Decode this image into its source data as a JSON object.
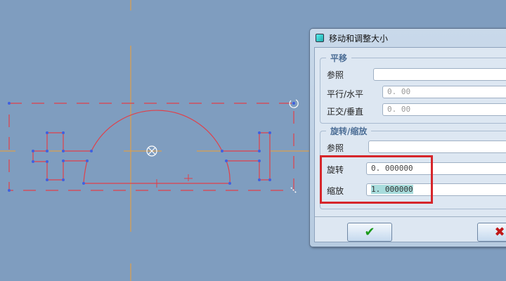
{
  "dialog": {
    "title": "移动和调整大小",
    "translate_group": "平移",
    "translate_ref_label": "参照",
    "translate_ref_value": "",
    "parallel_label": "平行/水平",
    "parallel_value": "0. 00",
    "ortho_label": "正交/垂直",
    "ortho_value": "0. 00",
    "rotscale_group": "旋转/缩放",
    "rot_ref_label": "参照",
    "rot_ref_value": "",
    "rotate_label": "旋转",
    "rotate_value": "0. 000000",
    "scale_label": "缩放",
    "scale_value": "1. 000000",
    "ok_icon": "✔",
    "cancel_icon": "✖"
  },
  "colors": {
    "sketch": "#e0404a",
    "axis": "#f0a030",
    "vertex": "#4060e0",
    "highlight": "#d6262b"
  }
}
